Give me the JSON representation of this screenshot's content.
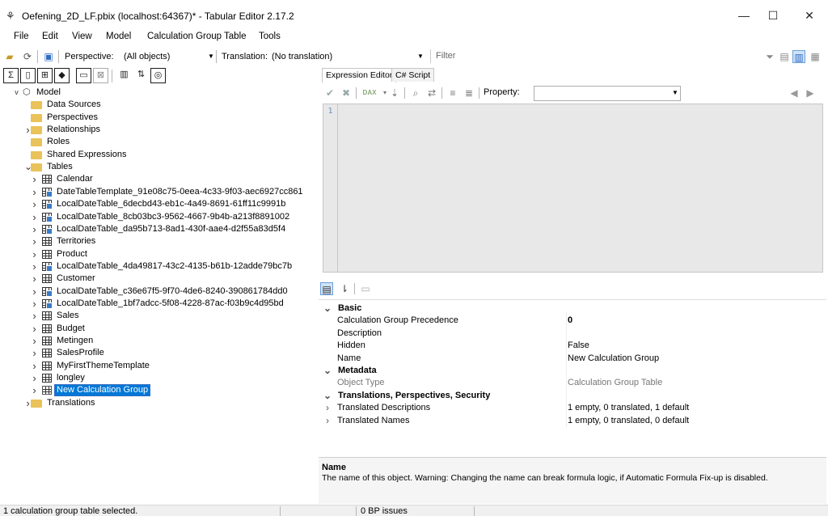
{
  "window": {
    "title": "Oefening_2D_LF.pbix (localhost:64367)* - Tabular Editor 2.17.2",
    "minimize": "—",
    "maximize": "☐",
    "close": "✕"
  },
  "menu": [
    "File",
    "Edit",
    "View",
    "Model",
    "Calculation Group Table",
    "Tools"
  ],
  "toolbar": {
    "perspective_label": "Perspective:",
    "perspective_value": "(All objects)",
    "translation_label": "Translation:",
    "translation_value": "(No translation)",
    "filter_placeholder": "Filter"
  },
  "tree": {
    "model": "Model",
    "items": [
      {
        "label": "Data Sources",
        "kind": "folder",
        "level": 1,
        "chevron": ""
      },
      {
        "label": "Perspectives",
        "kind": "folder",
        "level": 1,
        "chevron": ""
      },
      {
        "label": "Relationships",
        "kind": "folder",
        "level": 1,
        "chevron": ">"
      },
      {
        "label": "Roles",
        "kind": "folder",
        "level": 1,
        "chevron": ""
      },
      {
        "label": "Shared Expressions",
        "kind": "folder",
        "level": 1,
        "chevron": ""
      },
      {
        "label": "Tables",
        "kind": "folder-open",
        "level": 1,
        "chevron": "v"
      },
      {
        "label": "Calendar",
        "kind": "table",
        "level": 2,
        "chevron": ">"
      },
      {
        "label": "DateTableTemplate_91e08c75-0eea-4c33-9f03-aec6927cc861",
        "kind": "datetable",
        "level": 2,
        "chevron": ">"
      },
      {
        "label": "LocalDateTable_6decbd43-eb1c-4a49-8691-61ff11c9991b",
        "kind": "datetable",
        "level": 2,
        "chevron": ">"
      },
      {
        "label": "LocalDateTable_8cb03bc3-9562-4667-9b4b-a213f8891002",
        "kind": "datetable",
        "level": 2,
        "chevron": ">"
      },
      {
        "label": "LocalDateTable_da95b713-8ad1-430f-aae4-d2f55a83d5f4",
        "kind": "datetable",
        "level": 2,
        "chevron": ">"
      },
      {
        "label": "Territories",
        "kind": "table",
        "level": 2,
        "chevron": ">"
      },
      {
        "label": "Product",
        "kind": "table",
        "level": 2,
        "chevron": ">"
      },
      {
        "label": "LocalDateTable_4da49817-43c2-4135-b61b-12adde79bc7b",
        "kind": "datetable",
        "level": 2,
        "chevron": ">"
      },
      {
        "label": "Customer",
        "kind": "table",
        "level": 2,
        "chevron": ">"
      },
      {
        "label": "LocalDateTable_c36e67f5-9f70-4de6-8240-390861784dd0",
        "kind": "datetable",
        "level": 2,
        "chevron": ">"
      },
      {
        "label": "LocalDateTable_1bf7adcc-5f08-4228-87ac-f03b9c4d95bd",
        "kind": "datetable",
        "level": 2,
        "chevron": ">"
      },
      {
        "label": "Sales",
        "kind": "table",
        "level": 2,
        "chevron": ">"
      },
      {
        "label": "Budget",
        "kind": "table",
        "level": 2,
        "chevron": ">"
      },
      {
        "label": "Metingen",
        "kind": "table",
        "level": 2,
        "chevron": ">"
      },
      {
        "label": "SalesProfile",
        "kind": "table",
        "level": 2,
        "chevron": ">"
      },
      {
        "label": "MyFirstThemeTemplate",
        "kind": "table",
        "level": 2,
        "chevron": ">"
      },
      {
        "label": "longley",
        "kind": "table",
        "level": 2,
        "chevron": ">"
      },
      {
        "label": "New Calculation Group",
        "kind": "calcgroup",
        "level": 2,
        "chevron": ">",
        "selected": true
      },
      {
        "label": "Translations",
        "kind": "folder",
        "level": 1,
        "chevron": ">"
      }
    ]
  },
  "editor": {
    "tabs": [
      "Expression Editor",
      "C# Script"
    ],
    "property_label": "Property:",
    "line_number": "1"
  },
  "properties": [
    {
      "type": "cat",
      "chevron": "v",
      "key": "Basic",
      "value": ""
    },
    {
      "type": "prop",
      "key": "Calculation Group Precedence",
      "value": "0",
      "bold": true
    },
    {
      "type": "prop",
      "key": "Description",
      "value": ""
    },
    {
      "type": "prop",
      "key": "Hidden",
      "value": "False"
    },
    {
      "type": "prop",
      "key": "Name",
      "value": "New Calculation Group"
    },
    {
      "type": "cat",
      "chevron": "v",
      "key": "Metadata",
      "value": ""
    },
    {
      "type": "dim",
      "key": "Object Type",
      "value": "Calculation Group Table"
    },
    {
      "type": "cat",
      "chevron": "v",
      "key": "Translations, Perspectives, Security",
      "value": ""
    },
    {
      "type": "sub",
      "chevron": ">",
      "key": "Translated Descriptions",
      "value": "1 empty, 0 translated, 1 default"
    },
    {
      "type": "sub",
      "chevron": ">",
      "key": "Translated Names",
      "value": "1 empty, 0 translated, 0 default"
    }
  ],
  "description": {
    "title": "Name",
    "text": "The name of this object. Warning: Changing the name can break formula logic, if Automatic Formula Fix-up is disabled."
  },
  "status": {
    "selection": "1 calculation group table selected.",
    "bp_issues": "0 BP issues"
  },
  "colors": {
    "selection": "#0078d7",
    "folder": "#e9c25a"
  }
}
